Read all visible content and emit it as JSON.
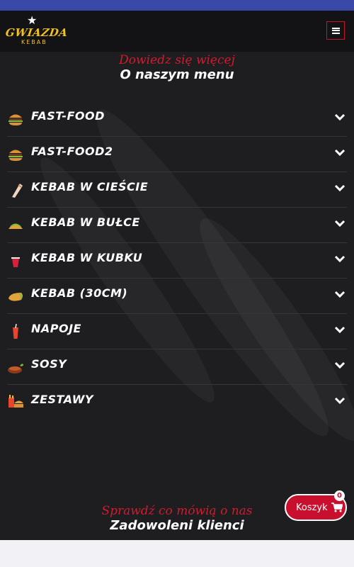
{
  "brand": {
    "name": "GWIAZDA",
    "tagline": "KEBAB"
  },
  "menu_section": {
    "eyebrow": "Dowiedz się więcej",
    "title": "O naszym menu"
  },
  "categories": [
    {
      "label": "FAST-FOOD",
      "icon": "burger-icon"
    },
    {
      "label": "FAST-FOOD2",
      "icon": "burger-icon"
    },
    {
      "label": "KEBAB W CIEŚCIE",
      "icon": "wrap-icon"
    },
    {
      "label": "KEBAB W BUŁCE",
      "icon": "taco-icon"
    },
    {
      "label": "KEBAB W KUBKU",
      "icon": "cup-icon"
    },
    {
      "label": "KEBAB (30CM)",
      "icon": "burrito-icon"
    },
    {
      "label": "NAPOJE",
      "icon": "drink-icon"
    },
    {
      "label": "SOSY",
      "icon": "sauce-icon"
    },
    {
      "label": "ZESTAWY",
      "icon": "combo-meal-icon"
    }
  ],
  "reviews_section": {
    "eyebrow": "Sprawdź co mówią o nas",
    "title": "Zadowoleni klienci"
  },
  "cart": {
    "label": "Koszyk",
    "count": "0"
  },
  "colors": {
    "accent": "#c8102e",
    "brand_yellow": "#f3c31a",
    "background": "#1e1d20",
    "status_bar": "#3a48a8"
  }
}
